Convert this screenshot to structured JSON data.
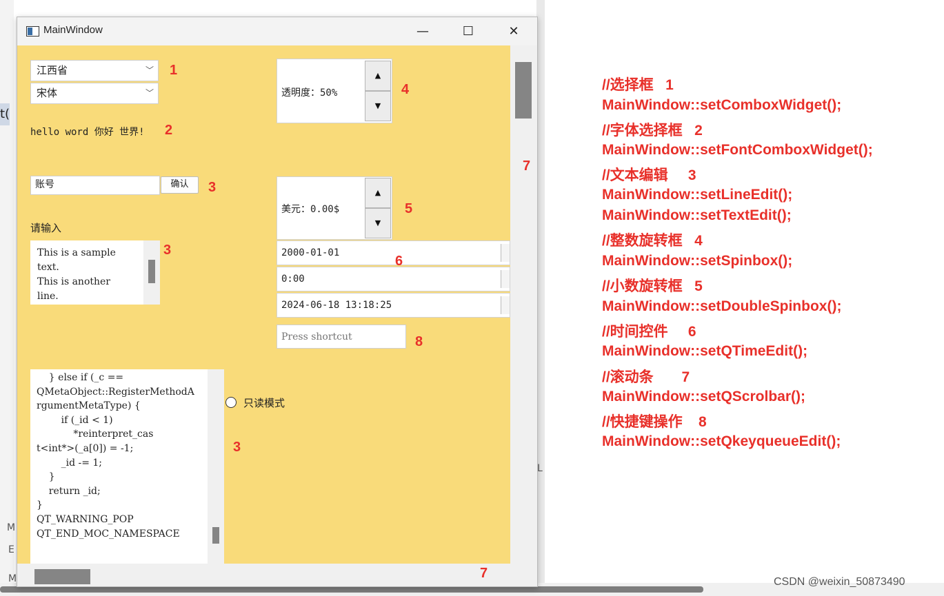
{
  "window": {
    "title": "MainWindow",
    "minimize": "—",
    "maximize": "☐",
    "close": "✕"
  },
  "combos": {
    "province": "江西省",
    "font": "宋体"
  },
  "font_preview": "hello word 你好 世界!",
  "line_edit": {
    "value": "账号",
    "confirm_label": "确认"
  },
  "prompt_label": "请输入",
  "text_edit": {
    "lines": [
      "This is a sample",
      "text.",
      "This is another",
      "line."
    ]
  },
  "spinbox": {
    "text": "透明度：50%"
  },
  "double_spinbox": {
    "text": "美元：0.00$"
  },
  "date_edit": "2000-01-01",
  "time_edit": "0:00",
  "datetime_edit": "2024-06-18 13:18:25",
  "key_sequence": {
    "placeholder": "Press shortcut"
  },
  "code_edit": {
    "lines": [
      "    } else if (_c ==",
      "QMetaObject::RegisterMethodA",
      "rgumentMetaType) {",
      "        if (_id < 1)",
      "            *reinterpret_cas",
      "t<int*>(_a[0]) = -1;",
      "        _id -= 1;",
      "    }",
      "    return _id;",
      "}",
      "QT_WARNING_POP",
      "QT_END_MOC_NAMESPACE"
    ]
  },
  "readonly_radio": "只读模式",
  "markers": {
    "m1": "1",
    "m2": "2",
    "m3": "3",
    "m4": "4",
    "m5": "5",
    "m6": "6",
    "m7": "7",
    "m8": "8"
  },
  "annotations": [
    "//选择框   1",
    "MainWindow::setComboxWidget();",
    "//字体选择框   2",
    "MainWindow::setFontComboxWidget();",
    "//文本编辑     3",
    "MainWindow::setLineEdit();",
    "MainWindow::setTextEdit();",
    "//整数旋转框   4",
    "MainWindow::setSpinbox();",
    "//小数旋转框   5",
    "MainWindow::setDoubleSpinbox();",
    "//时间控件     6",
    "MainWindow::setQTimeEdit();",
    "//滚动条       7",
    "MainWindow::setQScrolbar();",
    "//快捷键操作    8",
    "MainWindow::setQkeyqueueEdit();"
  ],
  "watermark": "CSDN @weixin_50873490",
  "background": {
    "left_glyph": "t(",
    "right_glyph": "L",
    "m1": "M",
    "m2": "M",
    "eq": "E"
  }
}
